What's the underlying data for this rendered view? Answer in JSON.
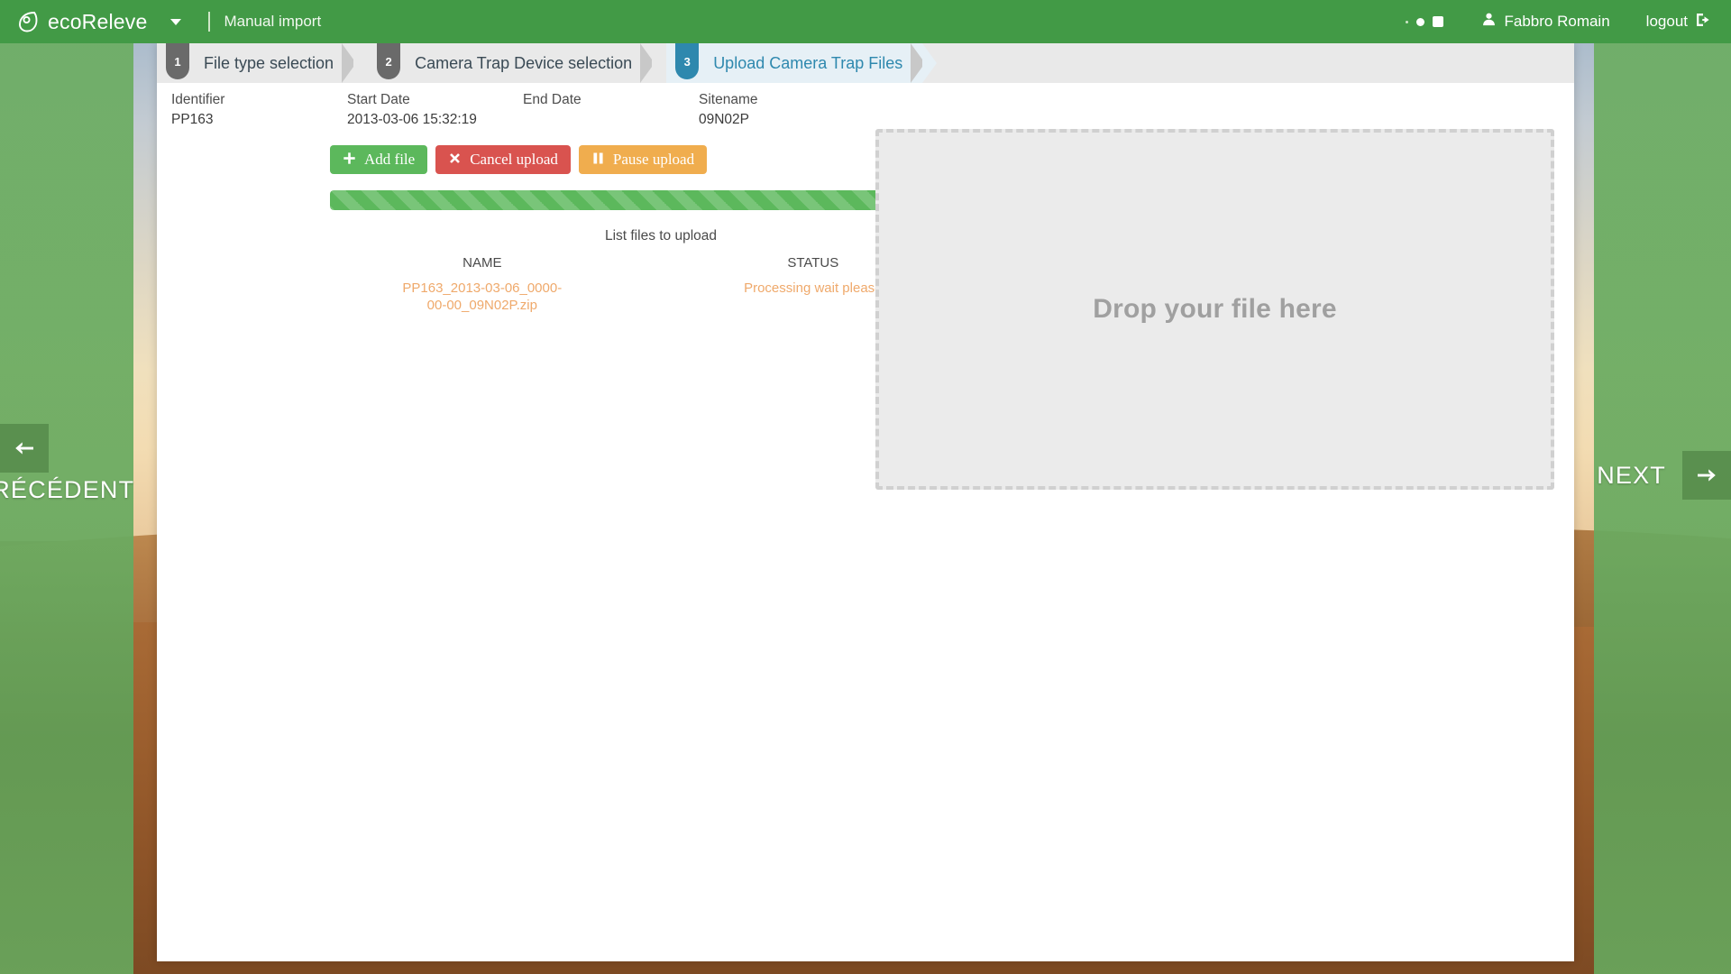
{
  "navbar": {
    "brand": "ecoReleve",
    "logo_icon": "leaf-logo-icon",
    "caret_icon": "chevron-down-icon",
    "section_title": "Manual import",
    "user_icon": "user-icon",
    "user_name": "Fabbro Romain",
    "logout_label": "logout",
    "logout_icon": "logout-icon",
    "brand_color": "#429a46"
  },
  "stepper": {
    "steps": [
      {
        "number": "1",
        "label": "File type selection",
        "active": false
      },
      {
        "number": "2",
        "label": "Camera Trap Device selection",
        "active": false
      },
      {
        "number": "3",
        "label": "Upload Camera Trap Files",
        "active": true
      }
    ],
    "active_color": "#2e88ae",
    "inactive_color": "#6a6a6a"
  },
  "meta": {
    "identifier_label": "Identifier",
    "identifier_value": "PP163",
    "start_date_label": "Start Date",
    "start_date_value": "2013-03-06 15:32:19",
    "end_date_label": "End Date",
    "end_date_value": "",
    "sitename_label": "Sitename",
    "sitename_value": "09N02P"
  },
  "actions": {
    "add_file_label": "Add  file",
    "add_file_icon": "plus-icon",
    "cancel_upload_label": "Cancel  upload",
    "cancel_upload_icon": "cross-icon",
    "pause_upload_label": "Pause  upload",
    "pause_upload_icon": "pause-icon",
    "add_color": "#5cb85c",
    "cancel_color": "#d9534f",
    "pause_color": "#f0ad4e"
  },
  "progress": {
    "percent": 100,
    "striped": true,
    "color": "#5cb85c"
  },
  "file_list": {
    "title": "List files to upload",
    "columns": [
      "NAME",
      "STATUS"
    ],
    "rows": [
      {
        "name": "PP163_2013-03-06_0000-00-00_09N02P.zip",
        "status": "Processing wait please"
      }
    ],
    "row_text_color": "#efa96b"
  },
  "dropzone": {
    "text": "Drop your file here",
    "background": "#ebebeb",
    "border_color": "#d0d0d0"
  },
  "side_nav": {
    "prev_label": "PRÉCÉDENT",
    "prev_icon": "arrow-left-icon",
    "next_label": "NEXT",
    "next_icon": "arrow-right-icon"
  }
}
